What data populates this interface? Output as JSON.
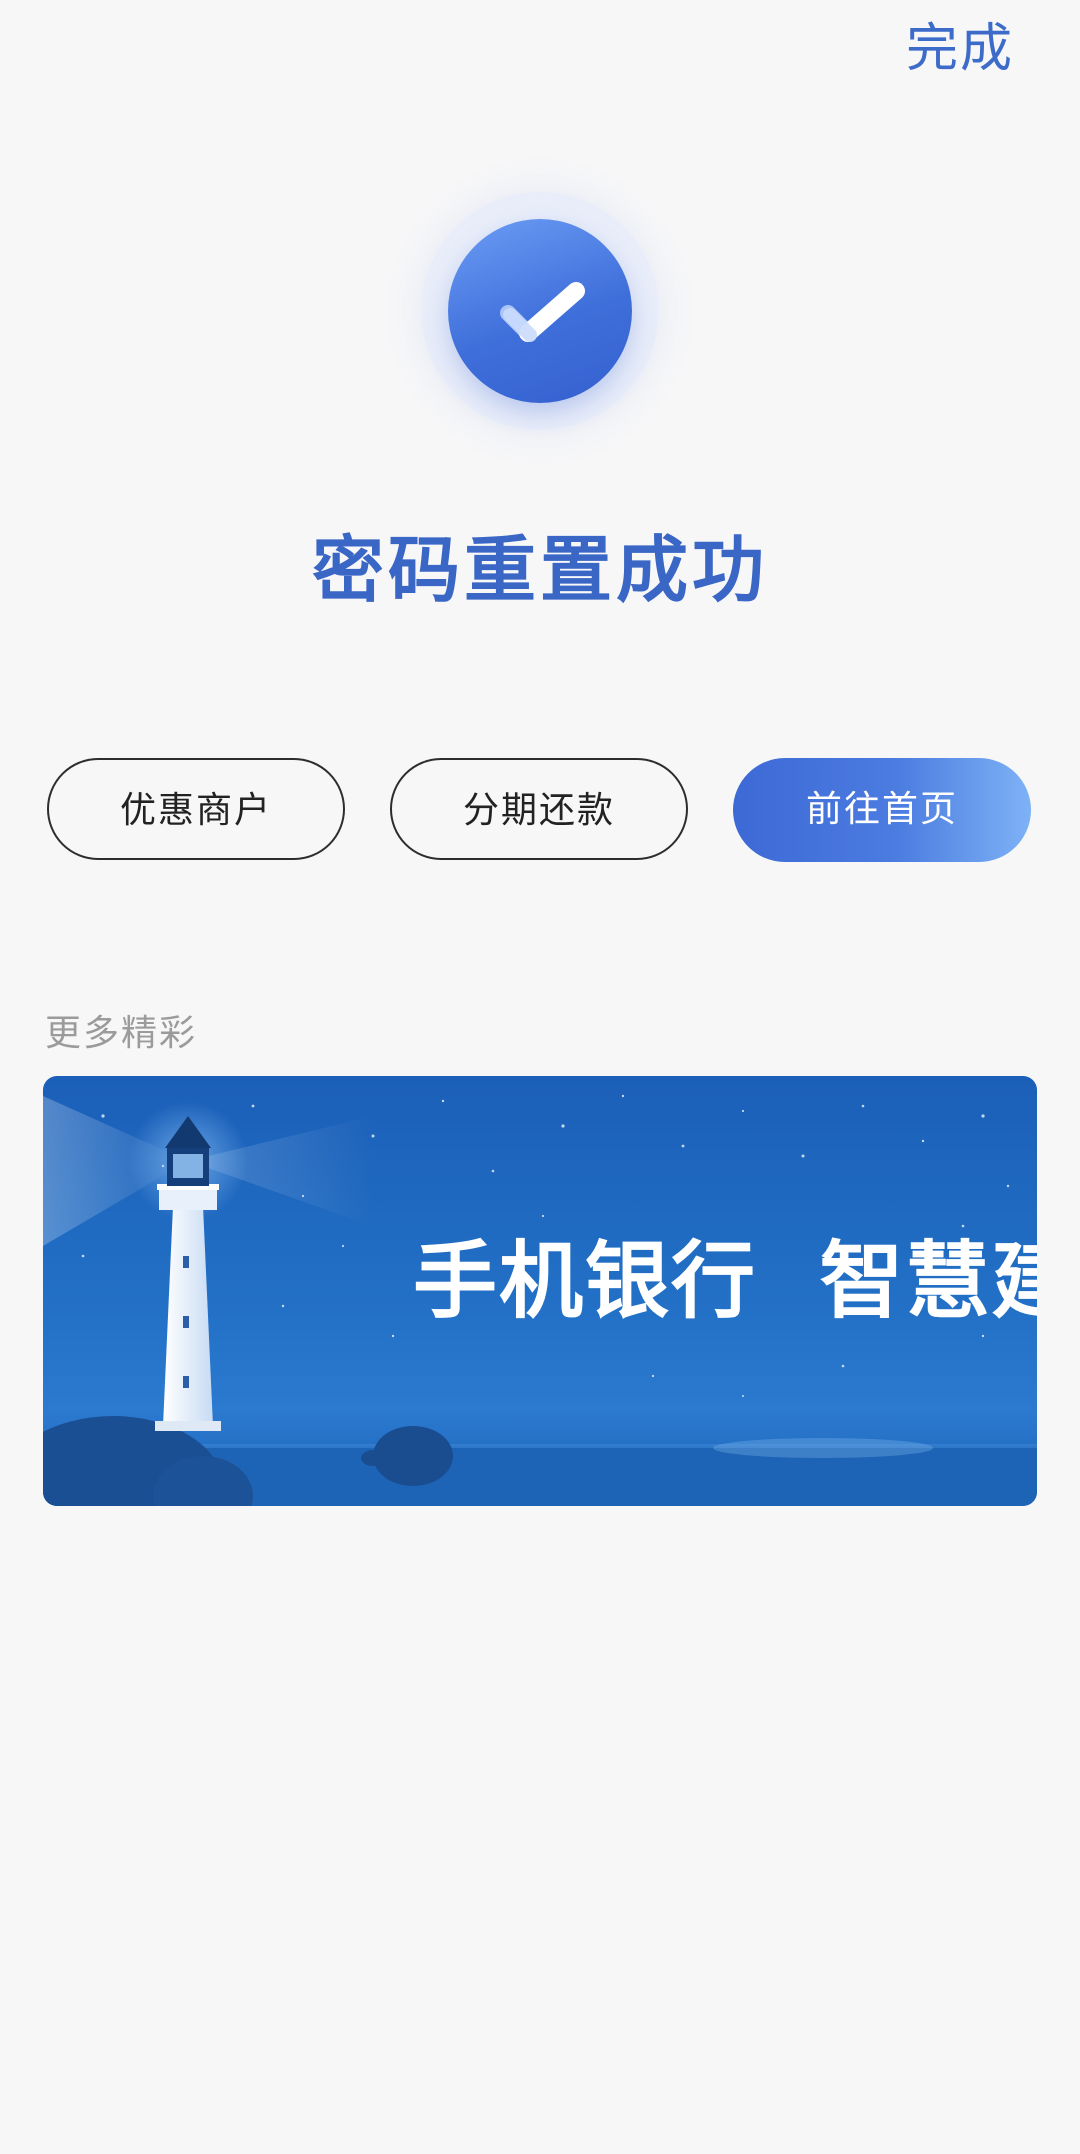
{
  "header": {
    "done_label": "完成"
  },
  "result": {
    "icon": "check-icon",
    "title": "密码重置成功"
  },
  "actions": {
    "merchants_label": "优惠商户",
    "installment_label": "分期还款",
    "home_label": "前往首页"
  },
  "more": {
    "section_label": "更多精彩",
    "banner_text": "手机银行  智慧建行"
  },
  "colors": {
    "accent": "#3c6bc9",
    "background": "#f7f7f8",
    "banner_blue": "#2371c7"
  }
}
